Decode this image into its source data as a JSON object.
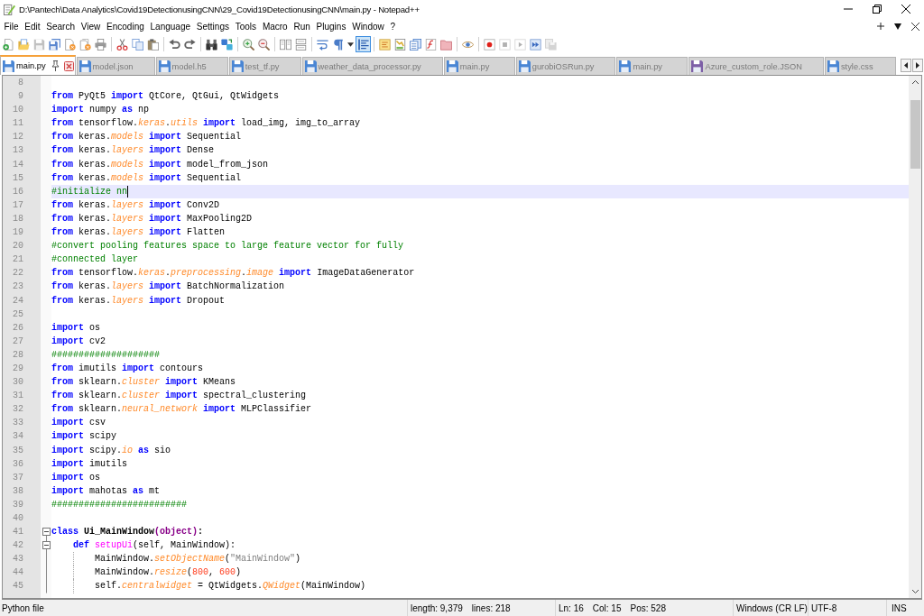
{
  "window": {
    "title": "D:\\Pantech\\Data Analytics\\Covid19DetectionusingCNN\\29_Covid19DetectionusingCNN\\main.py - Notepad++"
  },
  "menu": [
    "File",
    "Edit",
    "Search",
    "View",
    "Encoding",
    "Language",
    "Settings",
    "Tools",
    "Macro",
    "Run",
    "Plugins",
    "Window",
    "?"
  ],
  "toolbar": [
    [
      {
        "kind": "new",
        "on": false,
        "disabled": false
      },
      {
        "kind": "open",
        "on": false,
        "disabled": false
      },
      {
        "kind": "save",
        "on": false,
        "disabled": true
      },
      {
        "kind": "save_all",
        "on": false,
        "disabled": false
      },
      {
        "kind": "close",
        "on": false,
        "disabled": false
      },
      {
        "kind": "close_all",
        "on": false,
        "disabled": false
      },
      {
        "kind": "print",
        "on": false,
        "disabled": false
      }
    ],
    [
      {
        "kind": "cut",
        "on": false,
        "disabled": false
      },
      {
        "kind": "copy",
        "on": false,
        "disabled": false
      },
      {
        "kind": "paste",
        "on": false,
        "disabled": false
      }
    ],
    [
      {
        "kind": "undo",
        "on": false,
        "disabled": false
      },
      {
        "kind": "redo",
        "on": false,
        "disabled": false
      }
    ],
    [
      {
        "kind": "find",
        "on": false,
        "disabled": false
      },
      {
        "kind": "replace",
        "on": false,
        "disabled": false
      }
    ],
    [
      {
        "kind": "zoom_in",
        "on": false,
        "disabled": false
      },
      {
        "kind": "zoom_out",
        "on": false,
        "disabled": false
      }
    ],
    [
      {
        "kind": "sync_v",
        "on": false,
        "disabled": false
      },
      {
        "kind": "sync_h",
        "on": false,
        "disabled": false
      }
    ],
    [
      {
        "kind": "wrap",
        "on": false,
        "disabled": false
      },
      {
        "kind": "all_chars",
        "on": false,
        "disabled": false
      },
      {
        "kind": "menu",
        "on": false,
        "disabled": false
      },
      {
        "kind": "indent_guide",
        "on": true,
        "disabled": false
      }
    ],
    [
      {
        "kind": "udl",
        "on": false,
        "disabled": false
      },
      {
        "kind": "doc_map",
        "on": false,
        "disabled": false
      },
      {
        "kind": "doc_list",
        "on": false,
        "disabled": false
      },
      {
        "kind": "function_list",
        "on": false,
        "disabled": false
      },
      {
        "kind": "folder",
        "on": false,
        "disabled": false
      }
    ],
    [
      {
        "kind": "monitor",
        "on": false,
        "disabled": false
      }
    ],
    [
      {
        "kind": "record",
        "on": false,
        "disabled": false
      },
      {
        "kind": "stop",
        "on": false,
        "disabled": true
      },
      {
        "kind": "play",
        "on": false,
        "disabled": true
      },
      {
        "kind": "play_many",
        "on": false,
        "disabled": false
      },
      {
        "kind": "save_macro",
        "on": false,
        "disabled": true
      }
    ]
  ],
  "tabs": [
    {
      "label": "main.py",
      "selected": true,
      "color": "#4a86d4"
    },
    {
      "label": "model.json",
      "selected": false,
      "color": "#4a86d4"
    },
    {
      "label": "model.h5",
      "selected": false,
      "color": "#4a86d4"
    },
    {
      "label": "test_tf.py",
      "selected": false,
      "color": "#4a86d4"
    },
    {
      "label": "weather_data_processor.py",
      "selected": false,
      "color": "#4a86d4"
    },
    {
      "label": "main.py",
      "selected": false,
      "color": "#4a86d4"
    },
    {
      "label": "gurobiOSRun.py",
      "selected": false,
      "color": "#4a86d4"
    },
    {
      "label": "main.py",
      "selected": false,
      "color": "#4a86d4"
    },
    {
      "label": "Azure_custom_role.JSON",
      "selected": false,
      "color": "#7d5fa6"
    },
    {
      "label": "style.css",
      "selected": false,
      "color": "#4a86d4"
    }
  ],
  "editor": {
    "lines": [
      {
        "number": "8",
        "current": false
      },
      {
        "number": "9",
        "current": false,
        "tokens": [
          {
            "kind": "kw",
            "text": "from"
          },
          {
            "kind": "text",
            "text": " PyQt5"
          },
          {
            "kind": "kw",
            "text": " import"
          },
          {
            "kind": "text",
            "text": " QtCore, QtGui, QtWidgets"
          }
        ]
      },
      {
        "number": "10",
        "current": false,
        "tokens": [
          {
            "kind": "kw",
            "text": "import"
          },
          {
            "kind": "text",
            "text": " numpy"
          },
          {
            "kind": "kw",
            "text": " as"
          },
          {
            "kind": "text",
            "text": " np"
          }
        ]
      },
      {
        "number": "11",
        "current": false,
        "tokens": [
          {
            "kind": "kw",
            "text": "from"
          },
          {
            "kind": "text",
            "text": " tensorflow."
          },
          {
            "kind": "attr",
            "text": "keras"
          },
          {
            "kind": "text",
            "text": "."
          },
          {
            "kind": "attr",
            "text": "utils"
          },
          {
            "kind": "kw",
            "text": " import"
          },
          {
            "kind": "text",
            "text": " load_img, img_to_array"
          }
        ]
      },
      {
        "number": "12",
        "current": false,
        "tokens": [
          {
            "kind": "kw",
            "text": "from"
          },
          {
            "kind": "text",
            "text": " keras."
          },
          {
            "kind": "attr",
            "text": "models"
          },
          {
            "kind": "kw",
            "text": " import"
          },
          {
            "kind": "text",
            "text": " Sequential"
          }
        ]
      },
      {
        "number": "13",
        "current": false,
        "tokens": [
          {
            "kind": "kw",
            "text": "from"
          },
          {
            "kind": "text",
            "text": " keras."
          },
          {
            "kind": "attr",
            "text": "layers"
          },
          {
            "kind": "kw",
            "text": " import"
          },
          {
            "kind": "text",
            "text": " Dense"
          }
        ]
      },
      {
        "number": "14",
        "current": false,
        "tokens": [
          {
            "kind": "kw",
            "text": "from"
          },
          {
            "kind": "text",
            "text": " keras."
          },
          {
            "kind": "attr",
            "text": "models"
          },
          {
            "kind": "kw",
            "text": " import"
          },
          {
            "kind": "text",
            "text": " model_from_json"
          }
        ]
      },
      {
        "number": "15",
        "current": false,
        "tokens": [
          {
            "kind": "kw",
            "text": "from"
          },
          {
            "kind": "text",
            "text": " keras."
          },
          {
            "kind": "attr",
            "text": "models"
          },
          {
            "kind": "kw",
            "text": " import"
          },
          {
            "kind": "text",
            "text": " Sequential"
          }
        ]
      },
      {
        "number": "16",
        "current": true,
        "tokens": [
          {
            "kind": "comment",
            "text": "#initialize nn"
          }
        ]
      },
      {
        "number": "17",
        "current": false,
        "tokens": [
          {
            "kind": "kw",
            "text": "from"
          },
          {
            "kind": "text",
            "text": " keras."
          },
          {
            "kind": "attr",
            "text": "layers"
          },
          {
            "kind": "kw",
            "text": " import"
          },
          {
            "kind": "text",
            "text": " Conv2D"
          }
        ]
      },
      {
        "number": "18",
        "current": false,
        "tokens": [
          {
            "kind": "kw",
            "text": "from"
          },
          {
            "kind": "text",
            "text": " keras."
          },
          {
            "kind": "attr",
            "text": "layers"
          },
          {
            "kind": "kw",
            "text": " import"
          },
          {
            "kind": "text",
            "text": " MaxPooling2D"
          }
        ]
      },
      {
        "number": "19",
        "current": false,
        "tokens": [
          {
            "kind": "kw",
            "text": "from"
          },
          {
            "kind": "text",
            "text": " keras."
          },
          {
            "kind": "attr",
            "text": "layers"
          },
          {
            "kind": "kw",
            "text": " import"
          },
          {
            "kind": "text",
            "text": " Flatten"
          }
        ]
      },
      {
        "number": "20",
        "current": false,
        "tokens": [
          {
            "kind": "comment",
            "text": "#convert pooling features space to large feature vector for fully"
          }
        ]
      },
      {
        "number": "21",
        "current": false,
        "tokens": [
          {
            "kind": "comment",
            "text": "#connected layer"
          }
        ]
      },
      {
        "number": "22",
        "current": false,
        "tokens": [
          {
            "kind": "kw",
            "text": "from"
          },
          {
            "kind": "text",
            "text": " tensorflow."
          },
          {
            "kind": "attr",
            "text": "keras"
          },
          {
            "kind": "text",
            "text": "."
          },
          {
            "kind": "attr",
            "text": "preprocessing"
          },
          {
            "kind": "text",
            "text": "."
          },
          {
            "kind": "attr",
            "text": "image"
          },
          {
            "kind": "kw",
            "text": " import"
          },
          {
            "kind": "text",
            "text": " ImageDataGenerator"
          }
        ]
      },
      {
        "number": "23",
        "current": false,
        "tokens": [
          {
            "kind": "kw",
            "text": "from"
          },
          {
            "kind": "text",
            "text": " keras."
          },
          {
            "kind": "attr",
            "text": "layers"
          },
          {
            "kind": "kw",
            "text": " import"
          },
          {
            "kind": "text",
            "text": " BatchNormalization"
          }
        ]
      },
      {
        "number": "24",
        "current": false,
        "tokens": [
          {
            "kind": "kw",
            "text": "from"
          },
          {
            "kind": "text",
            "text": " keras."
          },
          {
            "kind": "attr",
            "text": "layers"
          },
          {
            "kind": "kw",
            "text": " import"
          },
          {
            "kind": "text",
            "text": " Dropout"
          }
        ]
      },
      {
        "number": "25",
        "current": false
      },
      {
        "number": "26",
        "current": false,
        "tokens": [
          {
            "kind": "kw",
            "text": "import"
          },
          {
            "kind": "text",
            "text": " os"
          }
        ]
      },
      {
        "number": "27",
        "current": false,
        "tokens": [
          {
            "kind": "kw",
            "text": "import"
          },
          {
            "kind": "text",
            "text": " cv2"
          }
        ]
      },
      {
        "number": "28",
        "current": false,
        "tokens": [
          {
            "kind": "comment",
            "text": "####################"
          }
        ]
      },
      {
        "number": "29",
        "current": false,
        "tokens": [
          {
            "kind": "kw",
            "text": "from"
          },
          {
            "kind": "text",
            "text": " imutils"
          },
          {
            "kind": "kw",
            "text": " import"
          },
          {
            "kind": "text",
            "text": " contours"
          }
        ]
      },
      {
        "number": "30",
        "current": false,
        "tokens": [
          {
            "kind": "kw",
            "text": "from"
          },
          {
            "kind": "text",
            "text": " sklearn."
          },
          {
            "kind": "attr",
            "text": "cluster"
          },
          {
            "kind": "kw",
            "text": " import"
          },
          {
            "kind": "text",
            "text": " KMeans"
          }
        ]
      },
      {
        "number": "31",
        "current": false,
        "tokens": [
          {
            "kind": "kw",
            "text": "from"
          },
          {
            "kind": "text",
            "text": " sklearn."
          },
          {
            "kind": "attr",
            "text": "cluster"
          },
          {
            "kind": "kw",
            "text": " import"
          },
          {
            "kind": "text",
            "text": " spectral_clustering"
          }
        ]
      },
      {
        "number": "32",
        "current": false,
        "tokens": [
          {
            "kind": "kw",
            "text": "from"
          },
          {
            "kind": "text",
            "text": " sklearn."
          },
          {
            "kind": "attr",
            "text": "neural_network"
          },
          {
            "kind": "kw",
            "text": " import"
          },
          {
            "kind": "text",
            "text": " MLPClassifier"
          }
        ]
      },
      {
        "number": "33",
        "current": false,
        "tokens": [
          {
            "kind": "kw",
            "text": "import"
          },
          {
            "kind": "text",
            "text": " csv"
          }
        ]
      },
      {
        "number": "34",
        "current": false,
        "tokens": [
          {
            "kind": "kw",
            "text": "import"
          },
          {
            "kind": "text",
            "text": " scipy"
          }
        ]
      },
      {
        "number": "35",
        "current": false,
        "tokens": [
          {
            "kind": "kw",
            "text": "import"
          },
          {
            "kind": "text",
            "text": " scipy."
          },
          {
            "kind": "attr",
            "text": "io"
          },
          {
            "kind": "kw",
            "text": " as"
          },
          {
            "kind": "text",
            "text": " sio"
          }
        ]
      },
      {
        "number": "36",
        "current": false,
        "tokens": [
          {
            "kind": "kw",
            "text": "import"
          },
          {
            "kind": "text",
            "text": " imutils"
          }
        ]
      },
      {
        "number": "37",
        "current": false,
        "tokens": [
          {
            "kind": "kw",
            "text": "import"
          },
          {
            "kind": "text",
            "text": " os"
          }
        ]
      },
      {
        "number": "38",
        "current": false,
        "tokens": [
          {
            "kind": "kw",
            "text": "import"
          },
          {
            "kind": "text",
            "text": " mahotas"
          },
          {
            "kind": "kw",
            "text": " as"
          },
          {
            "kind": "text",
            "text": " mt"
          }
        ]
      },
      {
        "number": "39",
        "current": false,
        "tokens": [
          {
            "kind": "comment",
            "text": "#########################"
          }
        ]
      },
      {
        "number": "40",
        "current": false
      },
      {
        "number": "41",
        "current": false,
        "expanded": true,
        "tokens": [
          {
            "kind": "kw",
            "text": "class"
          },
          {
            "kind": "classname",
            "text": " Ui_MainWindow"
          },
          {
            "kind": "builtin",
            "text": "(object)"
          },
          {
            "kind": "op",
            "text": ":"
          }
        ],
        "children": [
          {
            "number": "42",
            "current": false,
            "expanded": true,
            "tokens": [
              {
                "kind": "kw",
                "text": "def"
              },
              {
                "kind": "funcdef",
                "text": " setupUi"
              },
              {
                "kind": "text",
                "text": "(self, MainWindow):"
              }
            ],
            "children": [
              {
                "number": "43",
                "current": false,
                "tokens": [
                  {
                    "kind": "text",
                    "text": "MainWindow."
                  },
                  {
                    "kind": "attr",
                    "text": "setObjectName"
                  },
                  {
                    "kind": "text",
                    "text": "("
                  },
                  {
                    "kind": "string",
                    "text": "\"MainWindow\""
                  },
                  {
                    "kind": "text",
                    "text": ")"
                  }
                ]
              },
              {
                "number": "44",
                "current": false,
                "tokens": [
                  {
                    "kind": "text",
                    "text": "MainWindow."
                  },
                  {
                    "kind": "attr",
                    "text": "resize"
                  },
                  {
                    "kind": "text",
                    "text": "("
                  },
                  {
                    "kind": "number",
                    "text": "800"
                  },
                  {
                    "kind": "text",
                    "text": ", "
                  },
                  {
                    "kind": "number",
                    "text": "600"
                  },
                  {
                    "kind": "text",
                    "text": ")"
                  }
                ]
              },
              {
                "number": "45",
                "current": false,
                "tokens": [
                  {
                    "kind": "text",
                    "text": "self."
                  },
                  {
                    "kind": "attr",
                    "text": "centralwidget"
                  },
                  {
                    "kind": "text",
                    "text": " = QtWidgets."
                  },
                  {
                    "kind": "attr",
                    "text": "QWidget"
                  },
                  {
                    "kind": "text",
                    "text": "(MainWindow)"
                  }
                ]
              }
            ]
          }
        ]
      }
    ]
  },
  "status_bar": {
    "file_type": "Python file",
    "length": "length: 9,379",
    "lines": "lines: 218",
    "line": "Ln: 16",
    "column": "Col: 15",
    "position": "Pos: 528",
    "line_ending": "Windows (CR LF)",
    "encoding": "UTF-8",
    "mode": "INS"
  }
}
